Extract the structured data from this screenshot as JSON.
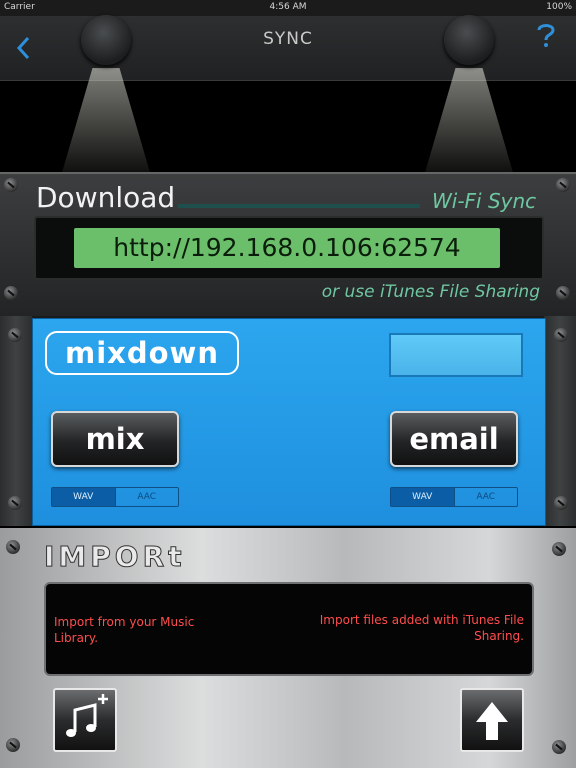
{
  "status_bar": {
    "carrier": "Carrier",
    "time": "4:56 AM",
    "battery": "100%"
  },
  "nav": {
    "back_icon": "chevron-left-icon",
    "title": "SYNC",
    "help_icon": "question-icon"
  },
  "download": {
    "title": "Download",
    "wifi_label": "Wi-Fi Sync",
    "url": "http://192.168.0.106:62574",
    "itunes_note": "or use iTunes File Sharing"
  },
  "mixdown": {
    "logo": "mixdown",
    "mix_button": "mix",
    "email_button": "email",
    "mix_format": {
      "options": [
        "WAV",
        "AAC"
      ],
      "selected": "WAV"
    },
    "email_format": {
      "options": [
        "WAV",
        "AAC"
      ],
      "selected": "WAV"
    }
  },
  "import": {
    "title": "IMPORt",
    "music_library_text": "Import from your Music Library.",
    "file_sharing_text": "Import files added with iTunes File Sharing.",
    "music_button_icon": "music-note-add-icon",
    "upload_button_icon": "arrow-up-icon"
  },
  "colors": {
    "accent": "#2f8fd8",
    "wifi_text": "#6fc7a2",
    "url_box": "#6bbf6a",
    "mix_panel": "#2ca6ee",
    "import_text": "#ff4d4d"
  }
}
